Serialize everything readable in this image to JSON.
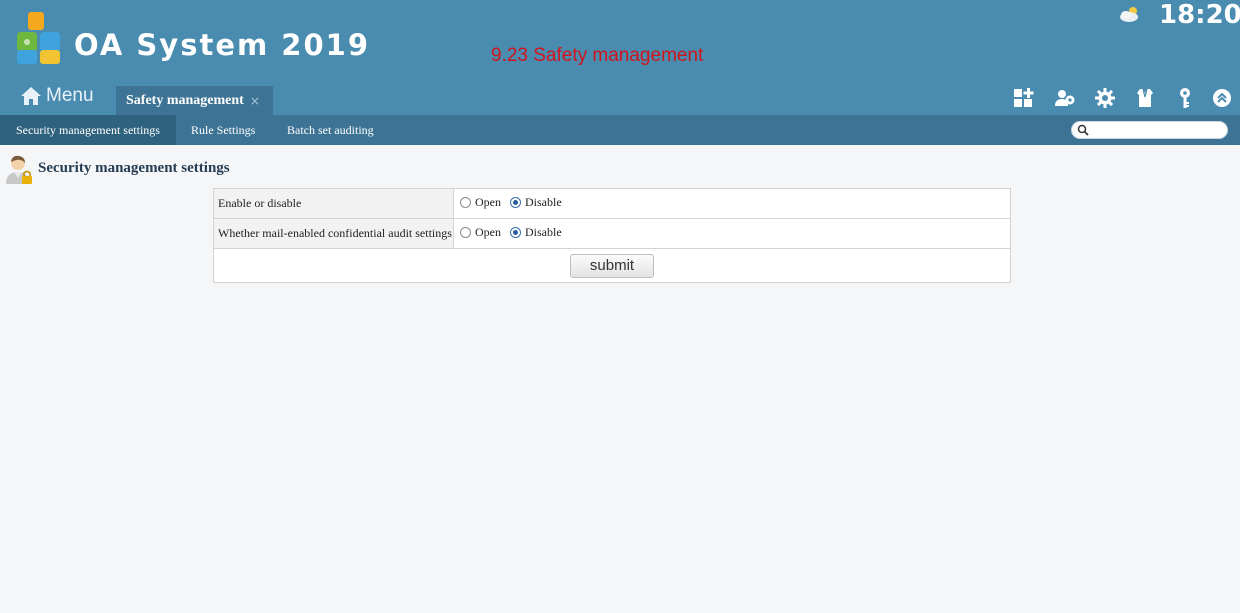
{
  "header": {
    "app_title": "OA System 2019",
    "banner": "9.23 Safety management",
    "clock": "18:20"
  },
  "nav": {
    "menu_label": "Menu",
    "tab_label": "Safety management",
    "tab_close": "×"
  },
  "subnav": {
    "items": [
      "Security management settings",
      "Rule Settings",
      "Batch set auditing"
    ],
    "active": 0
  },
  "search": {
    "placeholder": ""
  },
  "section": {
    "title": "Security management settings"
  },
  "form": {
    "rows": [
      {
        "label": "Enable or disable",
        "options": [
          "Open",
          "Disable"
        ],
        "selected": "Disable"
      },
      {
        "label": "Whether mail-enabled confidential audit settings",
        "options": [
          "Open",
          "Disable"
        ],
        "selected": "Disable"
      }
    ],
    "submit_label": "submit"
  },
  "colors": {
    "header_bg": "#4a8cb0",
    "nav_bg": "#3d7394",
    "banner_text": "#d0141c"
  },
  "icons": [
    "logo-icon",
    "weather-icon",
    "home-icon",
    "dashboard-add-icon",
    "user-settings-icon",
    "gear-icon",
    "shirt-icon",
    "key-icon",
    "collapse-icon",
    "search-icon",
    "user-lock-icon"
  ]
}
